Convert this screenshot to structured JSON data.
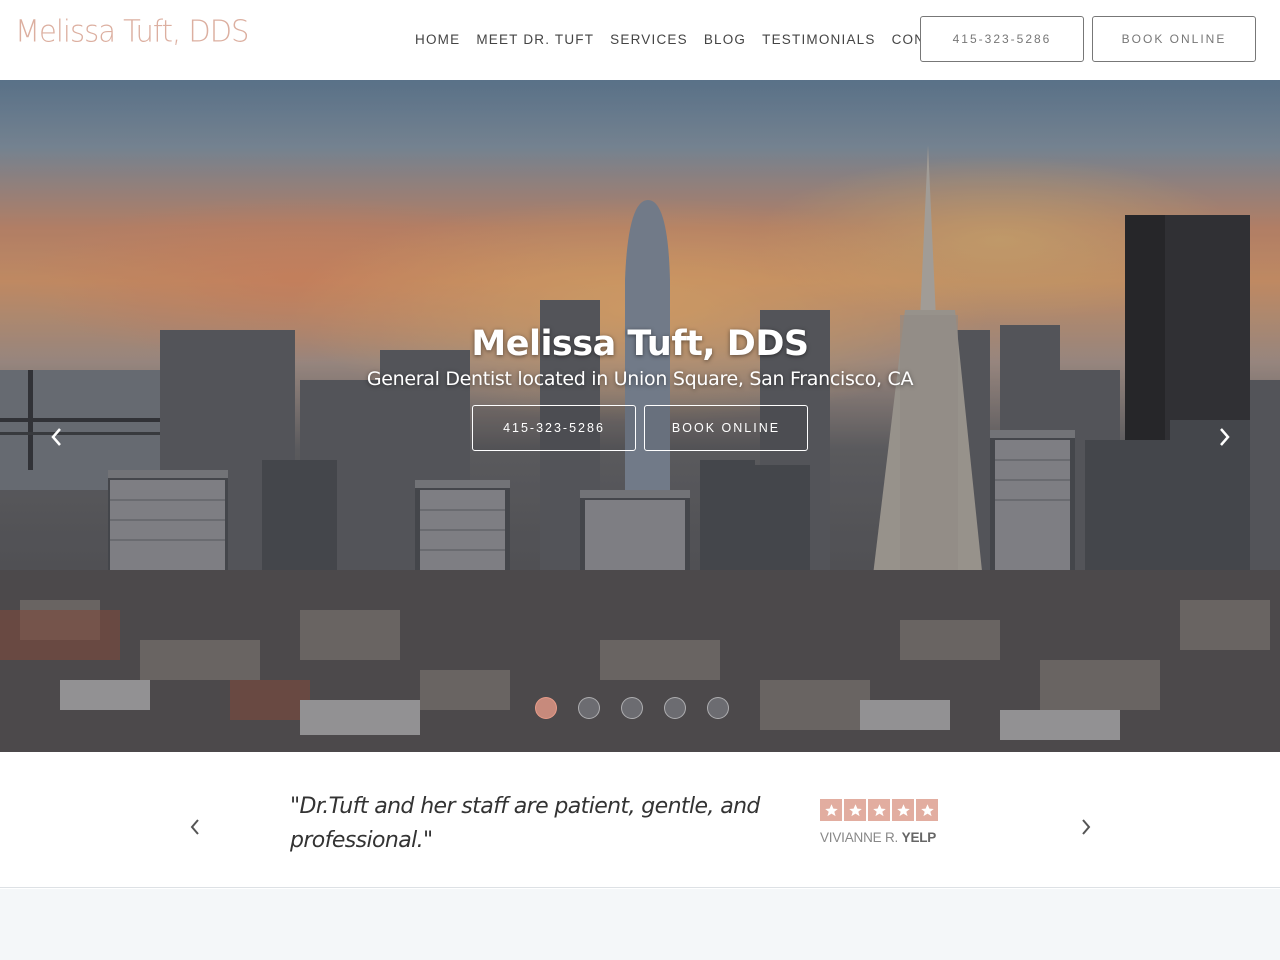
{
  "header": {
    "logo": "Melissa Tuft, DDS",
    "nav": [
      "HOME",
      "MEET DR. TUFT",
      "SERVICES",
      "BLOG",
      "TESTIMONIALS",
      "CONTACT"
    ],
    "phone_button": "415-323-5286",
    "book_button": "BOOK ONLINE"
  },
  "hero": {
    "title": "Melissa Tuft, DDS",
    "subtitle": "General Dentist located in Union Square, San Francisco, CA",
    "phone_button": "415-323-5286",
    "book_button": "BOOK ONLINE",
    "slides_total": 5,
    "active_slide": 1,
    "prev_icon": "chevron-left-icon",
    "next_icon": "chevron-right-icon"
  },
  "testimonial": {
    "quote": "\"Dr.Tuft and her staff are patient, gentle, and professional.\"",
    "rating": 5,
    "rating_max": 5,
    "reviewer_name": "VIVIANNE R.",
    "source": "YELP"
  },
  "colors": {
    "brand": "#dcafa0",
    "star_bg": "#e2ada0",
    "band_bg": "#f4f7f9"
  }
}
